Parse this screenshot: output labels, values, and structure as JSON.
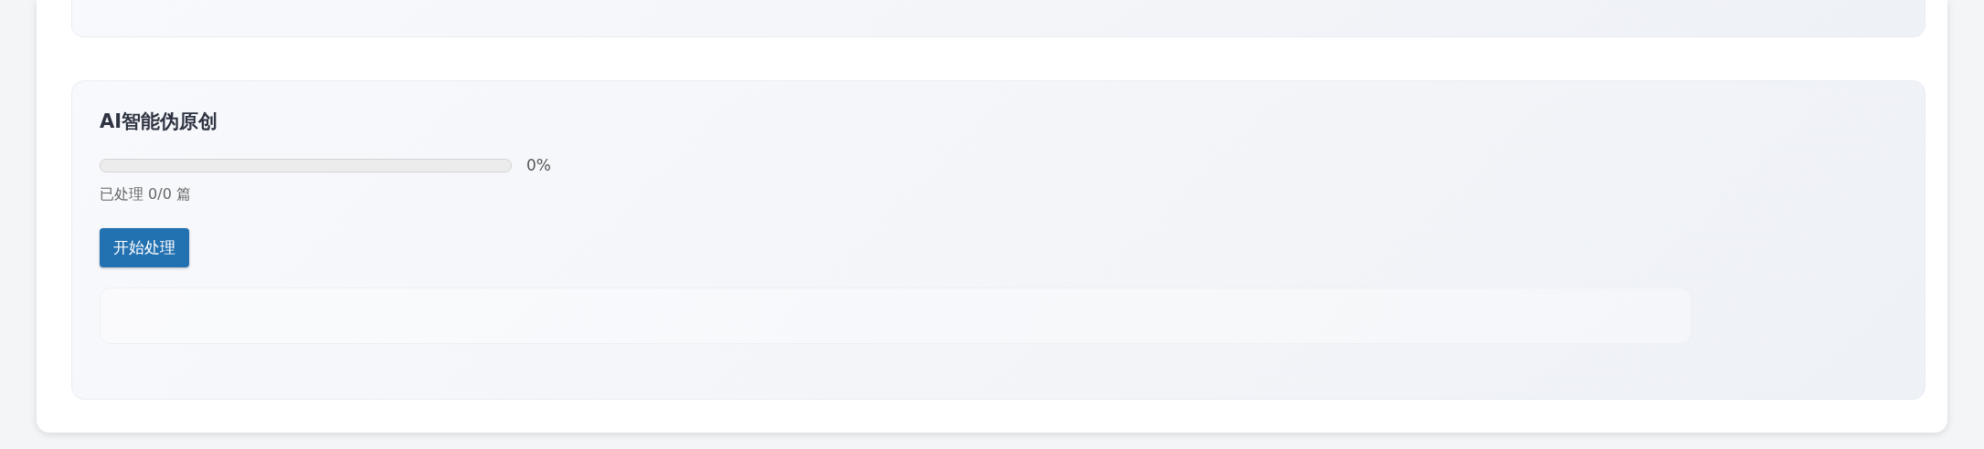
{
  "section": {
    "title": "AI智能伪原创",
    "progress": {
      "level": 0,
      "reading": "0%"
    },
    "status": "已处理 0/0 篇",
    "button": "开始处理"
  }
}
